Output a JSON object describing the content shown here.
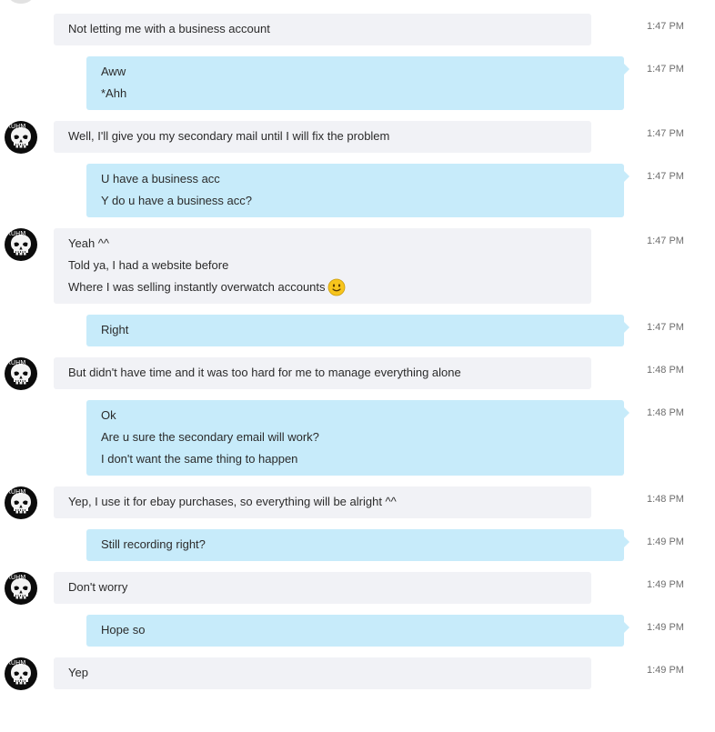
{
  "messages": [
    {
      "direction": "in",
      "time": "1:47 PM",
      "lines": [
        "Not letting me with a business account"
      ],
      "avatar": false
    },
    {
      "direction": "out",
      "time": "1:47 PM",
      "lines": [
        "Aww",
        "*Ahh"
      ]
    },
    {
      "direction": "in",
      "time": "1:47 PM",
      "lines": [
        "Well, I'll give you my secondary mail until I will fix the problem"
      ],
      "avatar": true
    },
    {
      "direction": "out",
      "time": "1:47 PM",
      "lines": [
        "U have a business acc",
        "Y do u have a business acc?"
      ]
    },
    {
      "direction": "in",
      "time": "1:47 PM",
      "lines": [
        "Yeah ^^",
        "Told ya, I had a website before",
        "Where I was selling instantly overwatch accounts"
      ],
      "avatar": true,
      "emoji": {
        "line": 2,
        "name": "smile-emoji-icon",
        "color": "#f7c51d"
      }
    },
    {
      "direction": "out",
      "time": "1:47 PM",
      "lines": [
        "Right"
      ]
    },
    {
      "direction": "in",
      "time": "1:48 PM",
      "lines": [
        "But didn't have time and it was too hard for me to manage everything alone"
      ],
      "avatar": true
    },
    {
      "direction": "out",
      "time": "1:48 PM",
      "lines": [
        "Ok",
        "Are u sure the secondary email will work?",
        "I don't want the same thing to happen"
      ]
    },
    {
      "direction": "in",
      "time": "1:48 PM",
      "lines": [
        "Yep, I use it for ebay purchases, so everything will be alright ^^"
      ],
      "avatar": true
    },
    {
      "direction": "out",
      "time": "1:49 PM",
      "lines": [
        "Still recording right?"
      ]
    },
    {
      "direction": "in",
      "time": "1:49 PM",
      "lines": [
        "Don't worry"
      ],
      "avatar": true
    },
    {
      "direction": "out",
      "time": "1:49 PM",
      "lines": [
        "Hope so"
      ]
    },
    {
      "direction": "in",
      "time": "1:49 PM",
      "lines": [
        "Yep"
      ],
      "avatar": true
    }
  ],
  "avatar": {
    "name": "punisher-skull-avatar",
    "tag_text": "RUHM"
  },
  "colors": {
    "incoming_bubble": "#f1f2f6",
    "outgoing_bubble": "#c7ebfa",
    "timestamp": "#6e6e6e",
    "text": "#2b2b2b"
  }
}
